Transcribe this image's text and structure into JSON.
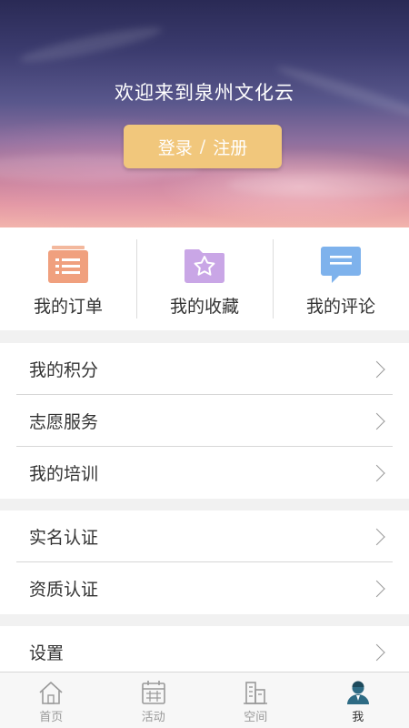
{
  "hero": {
    "welcome": "欢迎来到泉州文化云",
    "login_label": "登录",
    "separator": "/",
    "register_label": "注册"
  },
  "quick_links": [
    {
      "label": "我的订单",
      "icon": "orders-list-icon",
      "color": "#f0a07e"
    },
    {
      "label": "我的收藏",
      "icon": "star-folder-icon",
      "color": "#c9a6e6"
    },
    {
      "label": "我的评论",
      "icon": "comment-bubble-icon",
      "color": "#7eb2ec"
    }
  ],
  "groups": [
    {
      "items": [
        {
          "label": "我的积分"
        },
        {
          "label": "志愿服务"
        },
        {
          "label": "我的培训"
        }
      ]
    },
    {
      "items": [
        {
          "label": "实名认证"
        },
        {
          "label": "资质认证"
        }
      ]
    },
    {
      "items": [
        {
          "label": "设置"
        }
      ]
    }
  ],
  "tabbar": {
    "items": [
      {
        "label": "首页",
        "icon": "home-icon",
        "active": false
      },
      {
        "label": "活动",
        "icon": "calendar-icon",
        "active": false
      },
      {
        "label": "空间",
        "icon": "building-icon",
        "active": false
      },
      {
        "label": "我",
        "icon": "user-icon",
        "active": true
      }
    ]
  },
  "colors": {
    "button_bg": "#f1c77c",
    "active_tab_icon": "#2e6b84",
    "inactive_tab": "#999999"
  }
}
